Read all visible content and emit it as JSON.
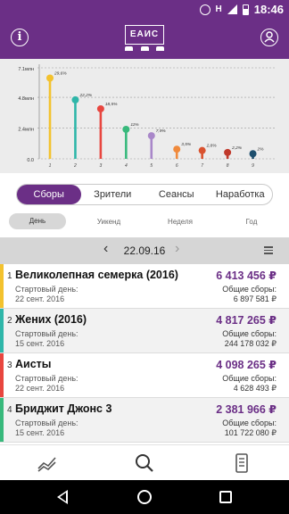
{
  "status_bar": {
    "network": "H",
    "time": "18:46"
  },
  "header": {
    "logo_text": "ЕАИС"
  },
  "chart_data": {
    "type": "bar",
    "categories": [
      "1",
      "2",
      "3",
      "4",
      "5",
      "6",
      "7",
      "8",
      "9"
    ],
    "values": [
      6.3,
      4.6,
      3.9,
      2.3,
      1.8,
      0.75,
      0.65,
      0.5,
      0.4
    ],
    "data_labels": [
      "29,6%",
      "22,2%",
      "18,5%",
      "11%",
      "7,9%",
      "3,5%",
      "2,8%",
      "2,2%",
      "2%"
    ],
    "colors": [
      "#f3c22e",
      "#2fb6a9",
      "#e8463f",
      "#38b97c",
      "#a987c9",
      "#f08a3c",
      "#d9522f",
      "#c0392b",
      "#1e4f6e"
    ],
    "yticks": [
      "0.0",
      "2.4млн",
      "4.8млн",
      "7.1млн"
    ],
    "ytick_values": [
      0,
      2.4,
      4.8,
      7.1
    ],
    "ylim": [
      0,
      7.1
    ],
    "grid": true,
    "title": "",
    "xlabel": "",
    "ylabel": ""
  },
  "tabs": [
    {
      "label": "Сборы",
      "active": true
    },
    {
      "label": "Зрители",
      "active": false
    },
    {
      "label": "Сеансы",
      "active": false
    },
    {
      "label": "Наработка",
      "active": false
    }
  ],
  "periods": [
    {
      "label": "День",
      "active": true
    },
    {
      "label": "Уикенд",
      "active": false
    },
    {
      "label": "Неделя",
      "active": false
    },
    {
      "label": "Год",
      "active": false
    }
  ],
  "date_nav": {
    "prev": "‹",
    "date": "22.09.16",
    "next": "›"
  },
  "films": [
    {
      "rank": "1",
      "title": "Великолепная семерка (2016)",
      "amount": "6 413 456 ₽",
      "start_label": "Стартовый день:",
      "start_date": "22 сент. 2016",
      "total_label": "Общие сборы:",
      "total": "6 897 581 ₽",
      "color": "#f3c22e"
    },
    {
      "rank": "2",
      "title": "Жених (2016)",
      "amount": "4 817 265 ₽",
      "start_label": "Стартовый день:",
      "start_date": "15 сент. 2016",
      "total_label": "Общие сборы:",
      "total": "244 178 032 ₽",
      "color": "#2fb6a9"
    },
    {
      "rank": "3",
      "title": "Аисты",
      "amount": "4 098 265 ₽",
      "start_label": "Стартовый день:",
      "start_date": "22 сент. 2016",
      "total_label": "Общие сборы:",
      "total": "4 628 493 ₽",
      "color": "#e8463f"
    },
    {
      "rank": "4",
      "title": "Бриджит Джонс 3",
      "amount": "2 381 966 ₽",
      "start_label": "Стартовый день:",
      "start_date": "15 сент. 2016",
      "total_label": "Общие сборы:",
      "total": "101 722 080 ₽",
      "color": "#38b97c"
    }
  ],
  "bottom_nav": [
    {
      "icon": "chart-icon"
    },
    {
      "icon": "search-icon"
    },
    {
      "icon": "cinema-icon"
    }
  ]
}
